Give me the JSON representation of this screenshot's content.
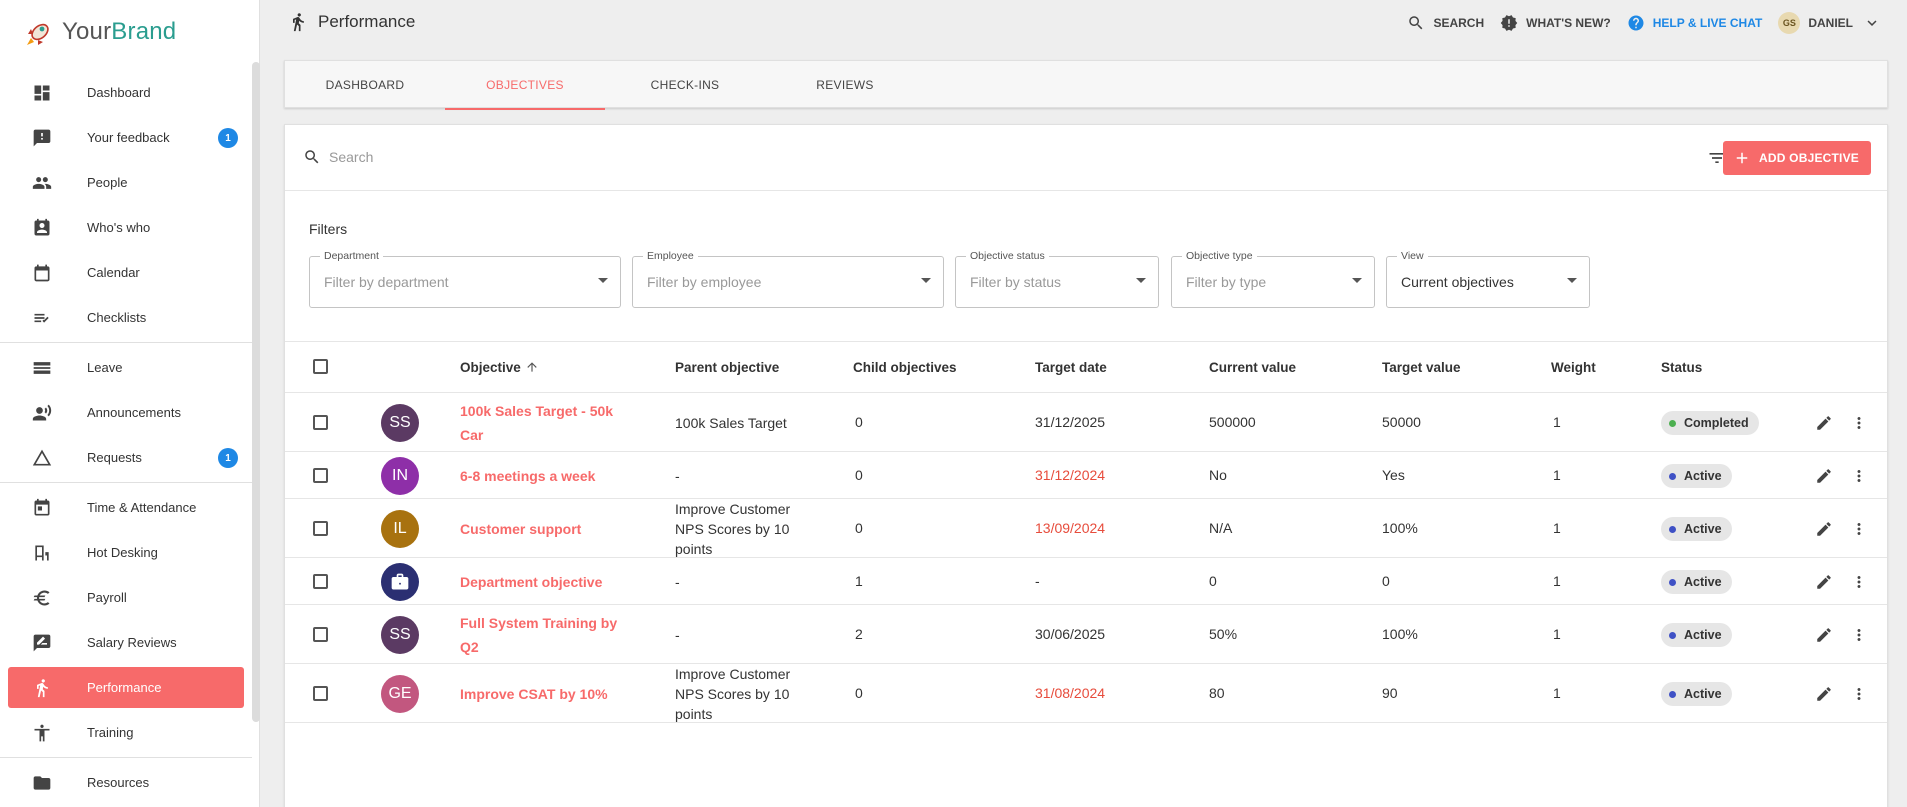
{
  "brand": {
    "prefix": "Your",
    "name": "Brand"
  },
  "sidebar": {
    "items": [
      {
        "label": "Dashboard",
        "icon": "dashboard-icon"
      },
      {
        "label": "Your feedback",
        "icon": "feedback-icon",
        "badge": "1"
      },
      {
        "label": "People",
        "icon": "people-icon"
      },
      {
        "label": "Who's who",
        "icon": "contact-card-icon"
      },
      {
        "label": "Calendar",
        "icon": "calendar-icon"
      },
      {
        "label": "Checklists",
        "icon": "checklist-icon"
      },
      {
        "label": "Leave",
        "icon": "leave-icon"
      },
      {
        "label": "Announcements",
        "icon": "announcement-icon"
      },
      {
        "label": "Requests",
        "icon": "requests-icon",
        "badge": "1"
      },
      {
        "label": "Time & Attendance",
        "icon": "time-attendance-icon"
      },
      {
        "label": "Hot Desking",
        "icon": "desk-icon"
      },
      {
        "label": "Payroll",
        "icon": "euro-icon"
      },
      {
        "label": "Salary Reviews",
        "icon": "salary-review-icon"
      },
      {
        "label": "Performance",
        "icon": "running-icon",
        "active": true
      },
      {
        "label": "Training",
        "icon": "training-icon"
      },
      {
        "label": "Resources",
        "icon": "folder-icon"
      }
    ]
  },
  "header": {
    "title": "Performance",
    "search": "SEARCH",
    "whats_new": "WHAT'S NEW?",
    "help": "HELP & LIVE CHAT",
    "user_initials": "GS",
    "user_name": "DANIEL"
  },
  "tabs": [
    "DASHBOARD",
    "OBJECTIVES",
    "CHECK-INS",
    "REVIEWS"
  ],
  "toolbar": {
    "search_placeholder": "Search",
    "add_label": "ADD OBJECTIVE"
  },
  "filters": {
    "title": "Filters",
    "fields": [
      {
        "label": "Department",
        "value": "Filter by department",
        "filled": false
      },
      {
        "label": "Employee",
        "value": "Filter by employee",
        "filled": false
      },
      {
        "label": "Objective status",
        "value": "Filter by status",
        "filled": false
      },
      {
        "label": "Objective type",
        "value": "Filter by type",
        "filled": false
      },
      {
        "label": "View",
        "value": "Current objectives",
        "filled": true
      }
    ]
  },
  "table": {
    "columns": [
      "Objective",
      "Parent objective",
      "Child objectives",
      "Target date",
      "Current value",
      "Target value",
      "Weight",
      "Status"
    ],
    "rows": [
      {
        "initials": "SS",
        "avatar_color": "#5b3a63",
        "objective": "100k Sales Target - 50k Car",
        "parent": "100k Sales Target",
        "children": "0",
        "target_date": "31/12/2025",
        "date_overdue": false,
        "current": "500000",
        "target": "50000",
        "weight": "1",
        "status": "Completed",
        "status_color": "#4caf50"
      },
      {
        "initials": "IN",
        "avatar_color": "#8e2fa8",
        "objective": "6-8 meetings a week",
        "parent": "-",
        "children": "0",
        "target_date": "31/12/2024",
        "date_overdue": true,
        "current": "No",
        "target": "Yes",
        "weight": "1",
        "status": "Active",
        "status_color": "#3f51c5"
      },
      {
        "initials": "IL",
        "avatar_color": "#a8720f",
        "objective": "Customer support",
        "parent": "Improve Customer NPS Scores by 10 points",
        "children": "0",
        "target_date": "13/09/2024",
        "date_overdue": true,
        "current": "N/A",
        "target": "100%",
        "weight": "1",
        "status": "Active",
        "status_color": "#3f51c5"
      },
      {
        "initials": "",
        "avatar_color": "#2b2f72",
        "avatar_icon": "briefcase-icon",
        "objective": "Department objective",
        "parent": "-",
        "children": "1",
        "target_date": "-",
        "date_overdue": false,
        "current": "0",
        "target": "0",
        "weight": "1",
        "status": "Active",
        "status_color": "#3f51c5"
      },
      {
        "initials": "SS",
        "avatar_color": "#5b3a63",
        "objective": "Full System Training by Q2",
        "parent": "-",
        "children": "2",
        "target_date": "30/06/2025",
        "date_overdue": false,
        "current": "50%",
        "target": "100%",
        "weight": "1",
        "status": "Active",
        "status_color": "#3f51c5"
      },
      {
        "initials": "GE",
        "avatar_color": "#c2577f",
        "objective": "Improve CSAT by 10%",
        "parent": "Improve Customer NPS Scores by 10 points",
        "children": "0",
        "target_date": "31/08/2024",
        "date_overdue": true,
        "current": "80",
        "target": "90",
        "weight": "1",
        "status": "Active",
        "status_color": "#3f51c5"
      }
    ]
  }
}
